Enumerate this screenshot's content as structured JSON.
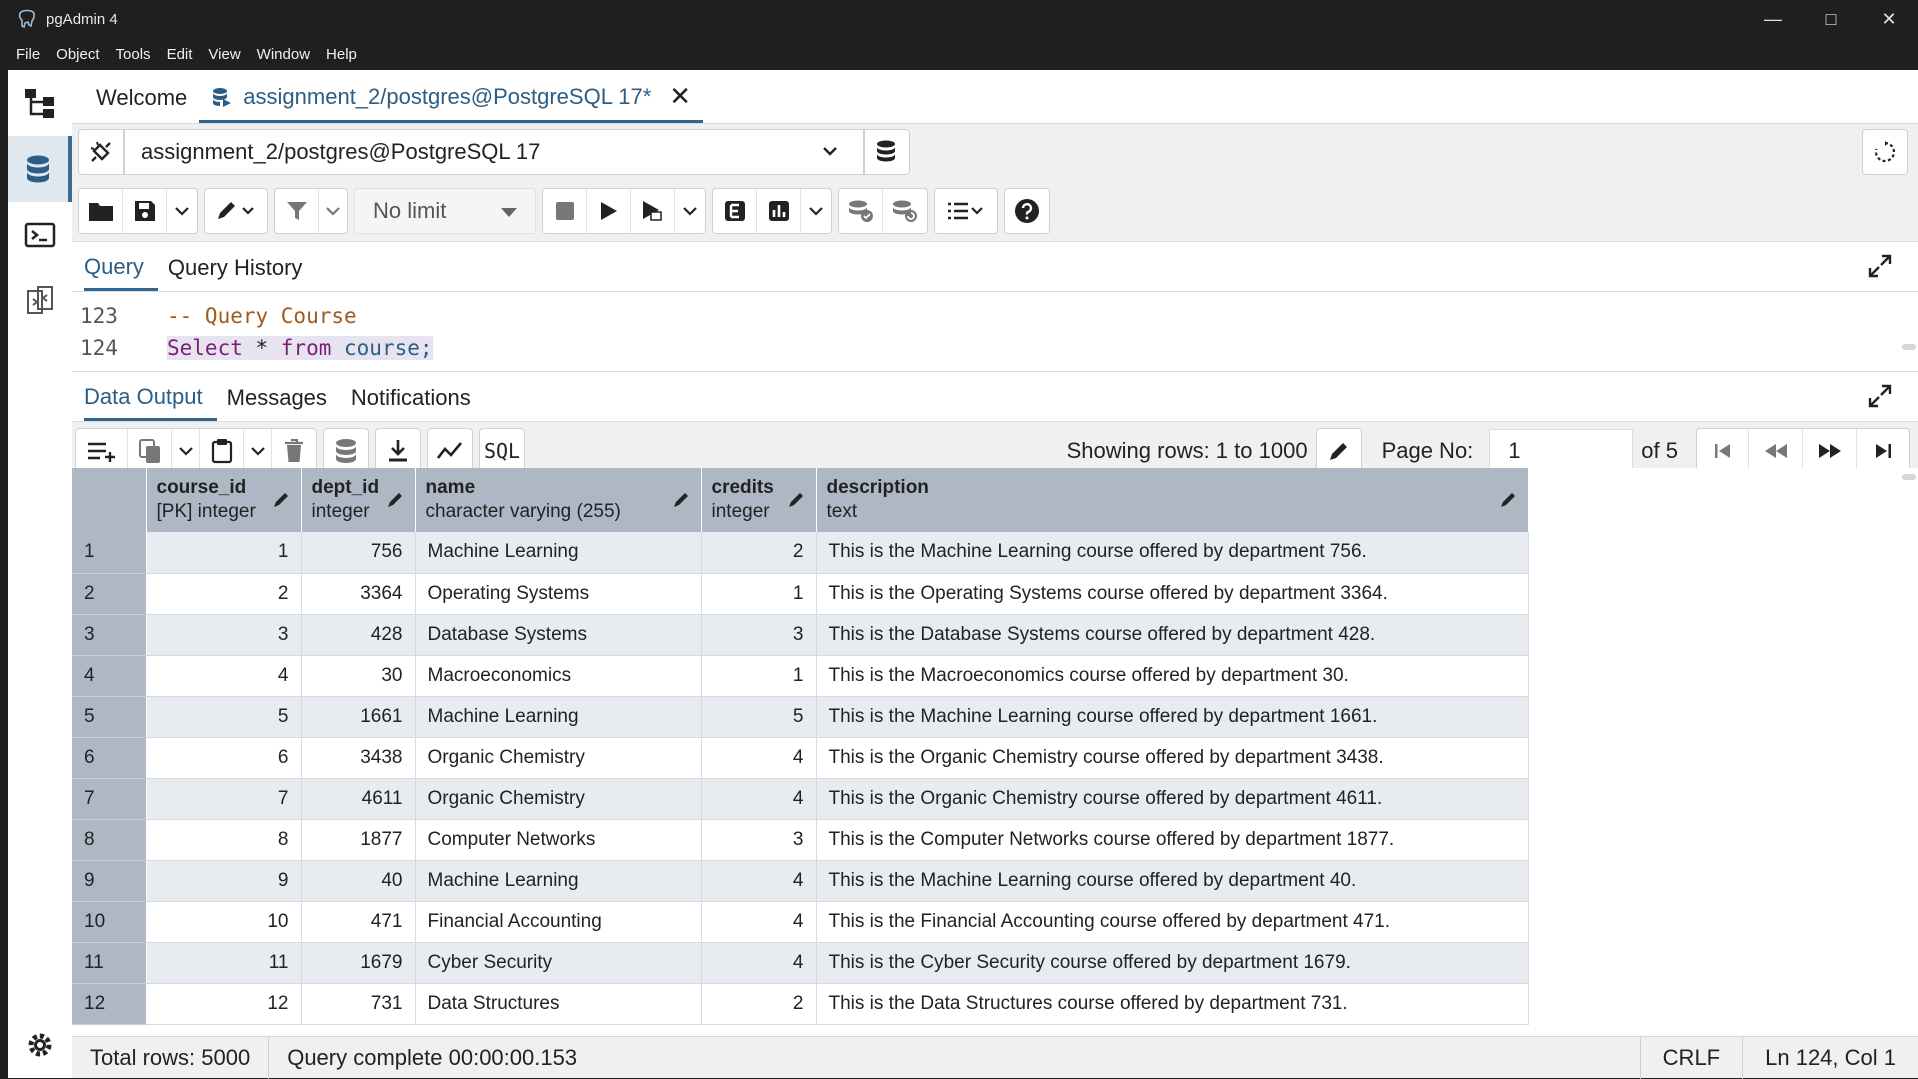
{
  "window": {
    "title": "pgAdmin 4"
  },
  "menu": [
    "File",
    "Object",
    "Tools",
    "Edit",
    "View",
    "Window",
    "Help"
  ],
  "tabs": [
    {
      "label": "Welcome"
    },
    {
      "label": "assignment_2/postgres@PostgreSQL 17*"
    }
  ],
  "connection": {
    "value": "assignment_2/postgres@PostgreSQL 17"
  },
  "toolbar": {
    "limit_value": "No limit"
  },
  "editor_tabs": [
    "Query",
    "Query History"
  ],
  "editor": {
    "lines": [
      {
        "num": "123",
        "text": "-- Query Course"
      },
      {
        "num": "124",
        "kw1": "Select",
        "mid": " * ",
        "kw2": "from",
        "rest": " course;"
      }
    ]
  },
  "output_tabs": [
    "Data Output",
    "Messages",
    "Notifications"
  ],
  "grid_toolbar": {
    "sql_label": "SQL",
    "rows_info": "Showing rows: 1 to 1000",
    "page_label": "Page No:",
    "page_value": "1",
    "page_of": "of 5"
  },
  "columns": [
    {
      "name": "course_id",
      "type": "[PK] integer"
    },
    {
      "name": "dept_id",
      "type": "integer"
    },
    {
      "name": "name",
      "type": "character varying (255)"
    },
    {
      "name": "credits",
      "type": "integer"
    },
    {
      "name": "description",
      "type": "text"
    }
  ],
  "rows": [
    [
      "1",
      "1",
      "756",
      "Machine Learning",
      "2",
      "This is the Machine Learning course offered by department 756."
    ],
    [
      "2",
      "2",
      "3364",
      "Operating Systems",
      "1",
      "This is the Operating Systems course offered by department 3364."
    ],
    [
      "3",
      "3",
      "428",
      "Database Systems",
      "3",
      "This is the Database Systems course offered by department 428."
    ],
    [
      "4",
      "4",
      "30",
      "Macroeconomics",
      "1",
      "This is the Macroeconomics course offered by department 30."
    ],
    [
      "5",
      "5",
      "1661",
      "Machine Learning",
      "5",
      "This is the Machine Learning course offered by department 1661."
    ],
    [
      "6",
      "6",
      "3438",
      "Organic Chemistry",
      "4",
      "This is the Organic Chemistry course offered by department 3438."
    ],
    [
      "7",
      "7",
      "4611",
      "Organic Chemistry",
      "4",
      "This is the Organic Chemistry course offered by department 4611."
    ],
    [
      "8",
      "8",
      "1877",
      "Computer Networks",
      "3",
      "This is the Computer Networks course offered by department 1877."
    ],
    [
      "9",
      "9",
      "40",
      "Machine Learning",
      "4",
      "This is the Machine Learning course offered by department 40."
    ],
    [
      "10",
      "10",
      "471",
      "Financial Accounting",
      "4",
      "This is the Financial Accounting course offered by department 471."
    ],
    [
      "11",
      "11",
      "1679",
      "Cyber Security",
      "4",
      "This is the Cyber Security course offered by department 1679."
    ],
    [
      "12",
      "12",
      "731",
      "Data Structures",
      "2",
      "This is the Data Structures course offered by department 731."
    ]
  ],
  "status": {
    "total_rows": "Total rows: 5000",
    "query_status": "Query complete 00:00:00.153",
    "line_ending": "CRLF",
    "cursor": "Ln 124, Col 1"
  }
}
